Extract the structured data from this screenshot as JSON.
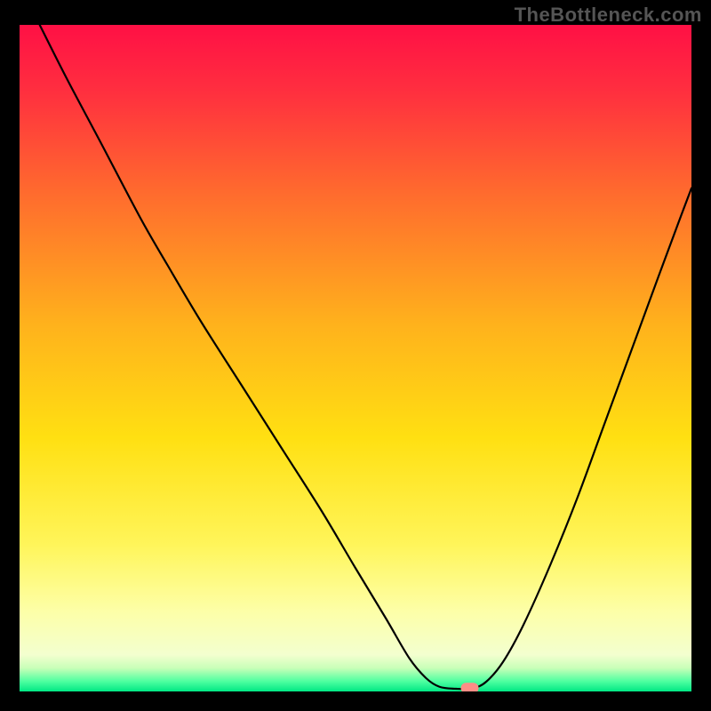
{
  "watermark": "TheBottleneck.com",
  "chart_data": {
    "type": "line",
    "title": "",
    "xlabel": "",
    "ylabel": "",
    "xlim": [
      0,
      100
    ],
    "ylim": [
      0,
      100
    ],
    "gradient_stops": [
      {
        "offset": 0.0,
        "color": "#ff1045"
      },
      {
        "offset": 0.1,
        "color": "#ff2f3f"
      },
      {
        "offset": 0.25,
        "color": "#ff6a2e"
      },
      {
        "offset": 0.45,
        "color": "#ffb21c"
      },
      {
        "offset": 0.62,
        "color": "#ffe012"
      },
      {
        "offset": 0.78,
        "color": "#fff55a"
      },
      {
        "offset": 0.88,
        "color": "#fdffa8"
      },
      {
        "offset": 0.945,
        "color": "#f3ffcf"
      },
      {
        "offset": 0.965,
        "color": "#c8ffb8"
      },
      {
        "offset": 0.985,
        "color": "#4dffa0"
      },
      {
        "offset": 1.0,
        "color": "#00e884"
      }
    ],
    "series": [
      {
        "name": "bottleneck-curve",
        "points": [
          {
            "x": 3.0,
            "y": 100.0
          },
          {
            "x": 7.0,
            "y": 92.0
          },
          {
            "x": 12.0,
            "y": 82.5
          },
          {
            "x": 18.0,
            "y": 71.0
          },
          {
            "x": 22.0,
            "y": 64.0
          },
          {
            "x": 27.0,
            "y": 55.5
          },
          {
            "x": 33.0,
            "y": 46.0
          },
          {
            "x": 39.0,
            "y": 36.5
          },
          {
            "x": 45.0,
            "y": 27.0
          },
          {
            "x": 50.0,
            "y": 18.5
          },
          {
            "x": 54.5,
            "y": 11.0
          },
          {
            "x": 58.0,
            "y": 5.0
          },
          {
            "x": 60.5,
            "y": 2.0
          },
          {
            "x": 62.5,
            "y": 0.7
          },
          {
            "x": 65.0,
            "y": 0.4
          },
          {
            "x": 67.5,
            "y": 0.5
          },
          {
            "x": 69.5,
            "y": 1.5
          },
          {
            "x": 72.0,
            "y": 4.5
          },
          {
            "x": 75.0,
            "y": 10.0
          },
          {
            "x": 79.0,
            "y": 19.0
          },
          {
            "x": 83.0,
            "y": 29.0
          },
          {
            "x": 87.0,
            "y": 40.0
          },
          {
            "x": 91.0,
            "y": 51.0
          },
          {
            "x": 95.0,
            "y": 62.0
          },
          {
            "x": 98.5,
            "y": 71.5
          },
          {
            "x": 100.0,
            "y": 75.5
          }
        ]
      }
    ],
    "marker": {
      "x": 67.0,
      "y": 0.5,
      "color": "#ff8d86"
    }
  }
}
